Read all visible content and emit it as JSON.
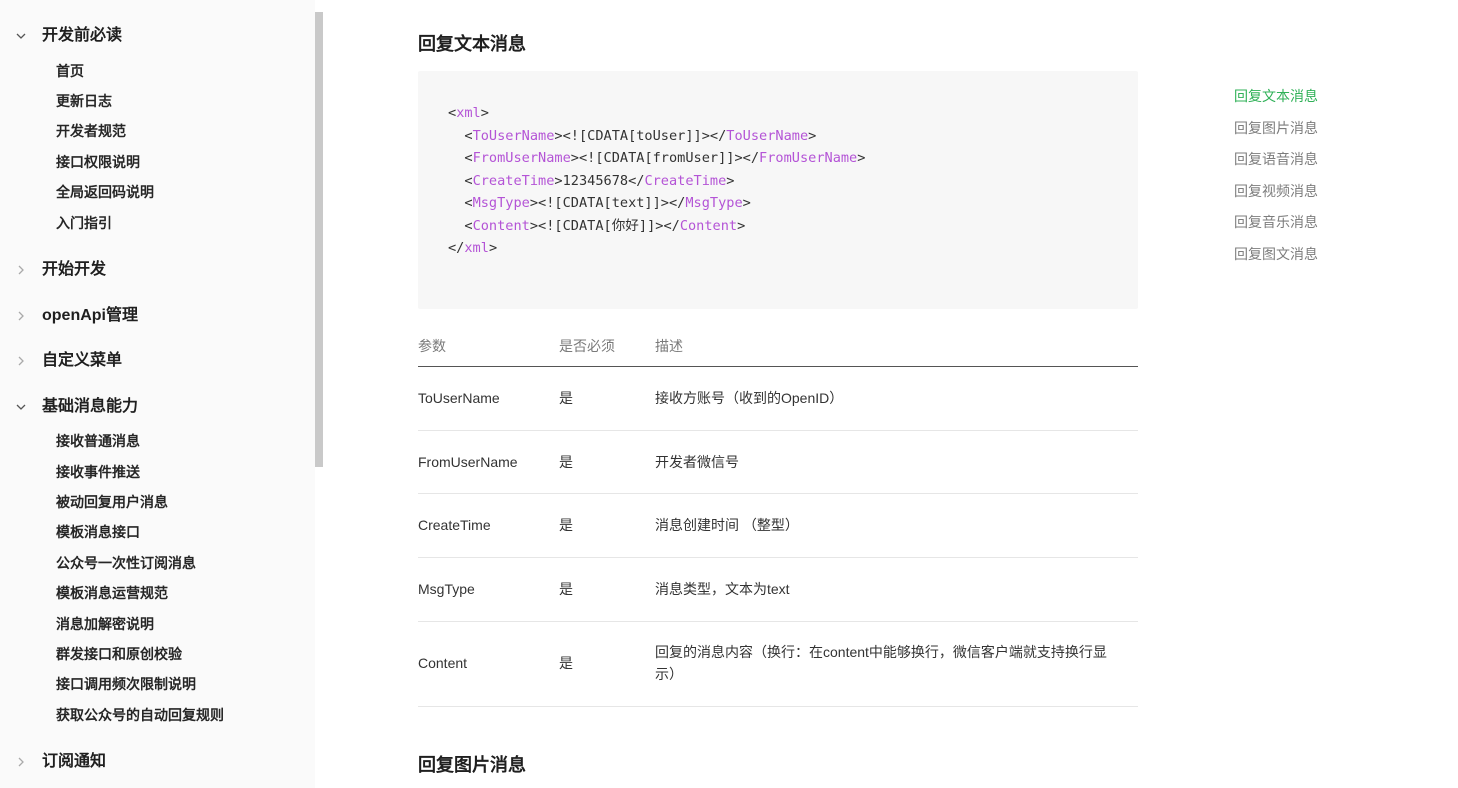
{
  "sidebar": {
    "sections": [
      {
        "title": "开发前必读",
        "expanded": true,
        "items": [
          "首页",
          "更新日志",
          "开发者规范",
          "接口权限说明",
          "全局返回码说明",
          "入门指引"
        ]
      },
      {
        "title": "开始开发",
        "expanded": false,
        "items": []
      },
      {
        "title": "openApi管理",
        "expanded": false,
        "items": []
      },
      {
        "title": "自定义菜单",
        "expanded": false,
        "items": []
      },
      {
        "title": "基础消息能力",
        "expanded": true,
        "items": [
          "接收普通消息",
          "接收事件推送",
          "被动回复用户消息",
          "模板消息接口",
          "公众号一次性订阅消息",
          "模板消息运营规范",
          "消息加解密说明",
          "群发接口和原创校验",
          "接口调用频次限制说明",
          "获取公众号的自动回复规则"
        ]
      },
      {
        "title": "订阅通知",
        "expanded": false,
        "items": []
      }
    ]
  },
  "main": {
    "section_title": "回复文本消息",
    "next_section_title": "回复图片消息",
    "code": {
      "lines": [
        {
          "indent": "",
          "parts": [
            [
              "p",
              "<"
            ],
            [
              "t",
              "xml"
            ],
            [
              "p",
              ">"
            ]
          ]
        },
        {
          "indent": "  ",
          "parts": [
            [
              "p",
              "<"
            ],
            [
              "t",
              "ToUserName"
            ],
            [
              "p",
              "><![CDATA[toUser]]></"
            ],
            [
              "t",
              "ToUserName"
            ],
            [
              "p",
              ">"
            ]
          ]
        },
        {
          "indent": "  ",
          "parts": [
            [
              "p",
              "<"
            ],
            [
              "t",
              "FromUserName"
            ],
            [
              "p",
              "><![CDATA[fromUser]]></"
            ],
            [
              "t",
              "FromUserName"
            ],
            [
              "p",
              ">"
            ]
          ]
        },
        {
          "indent": "  ",
          "parts": [
            [
              "p",
              "<"
            ],
            [
              "t",
              "CreateTime"
            ],
            [
              "p",
              ">12345678</"
            ],
            [
              "t",
              "CreateTime"
            ],
            [
              "p",
              ">"
            ]
          ]
        },
        {
          "indent": "  ",
          "parts": [
            [
              "p",
              "<"
            ],
            [
              "t",
              "MsgType"
            ],
            [
              "p",
              "><![CDATA[text]]></"
            ],
            [
              "t",
              "MsgType"
            ],
            [
              "p",
              ">"
            ]
          ]
        },
        {
          "indent": "  ",
          "parts": [
            [
              "p",
              "<"
            ],
            [
              "t",
              "Content"
            ],
            [
              "p",
              "><![CDATA[你好]]></"
            ],
            [
              "t",
              "Content"
            ],
            [
              "p",
              ">"
            ]
          ]
        },
        {
          "indent": "",
          "parts": [
            [
              "p",
              "</"
            ],
            [
              "t",
              "xml"
            ],
            [
              "p",
              ">"
            ]
          ]
        }
      ]
    },
    "table": {
      "headers": [
        "参数",
        "是否必须",
        "描述"
      ],
      "rows": [
        [
          "ToUserName",
          "是",
          "接收方账号（收到的OpenID）"
        ],
        [
          "FromUserName",
          "是",
          "开发者微信号"
        ],
        [
          "CreateTime",
          "是",
          "消息创建时间 （整型）"
        ],
        [
          "MsgType",
          "是",
          "消息类型，文本为text"
        ],
        [
          "Content",
          "是",
          "回复的消息内容（换行：在content中能够换行，微信客户端就支持换行显示）"
        ]
      ]
    }
  },
  "toc": {
    "items": [
      "回复文本消息",
      "回复图片消息",
      "回复语音消息",
      "回复视频消息",
      "回复音乐消息",
      "回复图文消息"
    ],
    "active_index": 0
  },
  "colors": {
    "tag": "#b454d6",
    "active_toc": "#2fb157"
  }
}
